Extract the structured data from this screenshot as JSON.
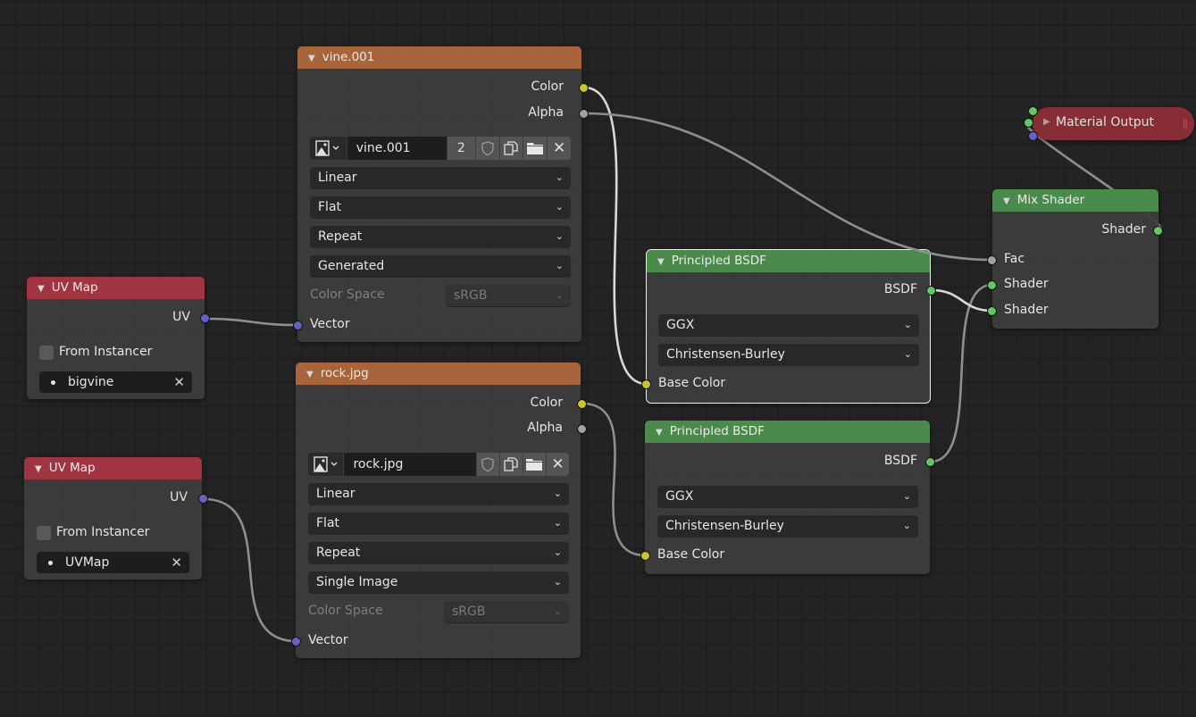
{
  "editor": "Shader Editor",
  "colors": {
    "background": "#232323",
    "texture_header": "#a8643a",
    "input_header": "#a03541",
    "shader_header": "#4a8a4a",
    "output_header": "#8c2e36",
    "socket_color": "#c7c729",
    "socket_float": "#a1a1a1",
    "socket_vector": "#6363c7",
    "socket_shader": "#63c763"
  },
  "nodes": {
    "vine": {
      "title": "vine.001",
      "outputs": [
        "Color",
        "Alpha"
      ],
      "image_name": "vine.001",
      "users": "2",
      "interpolation": "Linear",
      "projection": "Flat",
      "extension": "Repeat",
      "source": "Generated",
      "color_space_label": "Color Space",
      "color_space": "sRGB",
      "input": "Vector"
    },
    "rock": {
      "title": "rock.jpg",
      "outputs": [
        "Color",
        "Alpha"
      ],
      "image_name": "rock.jpg",
      "interpolation": "Linear",
      "projection": "Flat",
      "extension": "Repeat",
      "source": "Single Image",
      "color_space_label": "Color Space",
      "color_space": "sRGB",
      "input": "Vector"
    },
    "uvmap1": {
      "title": "UV Map",
      "output": "UV",
      "from_instancer": "From Instancer",
      "from_instancer_checked": false,
      "uv_map": "bigvine"
    },
    "uvmap2": {
      "title": "UV Map",
      "output": "UV",
      "from_instancer": "From Instancer",
      "from_instancer_checked": false,
      "uv_map": "UVMap"
    },
    "bsdf1": {
      "title": "Principled BSDF",
      "output": "BSDF",
      "distribution": "GGX",
      "subsurface_method": "Christensen-Burley",
      "input": "Base Color",
      "selected": true
    },
    "bsdf2": {
      "title": "Principled BSDF",
      "output": "BSDF",
      "distribution": "GGX",
      "subsurface_method": "Christensen-Burley",
      "input": "Base Color",
      "selected": false
    },
    "mix": {
      "title": "Mix Shader",
      "output": "Shader",
      "inputs": [
        "Fac",
        "Shader",
        "Shader"
      ]
    },
    "output": {
      "title": "Material Output",
      "collapsed": true
    }
  },
  "links": [
    {
      "from": "uvmap1.UV",
      "to": "vine.Vector"
    },
    {
      "from": "uvmap2.UV",
      "to": "rock.Vector"
    },
    {
      "from": "vine.Color",
      "to": "bsdf1.Base Color"
    },
    {
      "from": "vine.Alpha",
      "to": "mix.Fac"
    },
    {
      "from": "rock.Color",
      "to": "bsdf2.Base Color"
    },
    {
      "from": "bsdf1.BSDF",
      "to": "mix.Shader[2]"
    },
    {
      "from": "bsdf2.BSDF",
      "to": "mix.Shader[1]"
    },
    {
      "from": "mix.Shader",
      "to": "output.Surface"
    }
  ]
}
